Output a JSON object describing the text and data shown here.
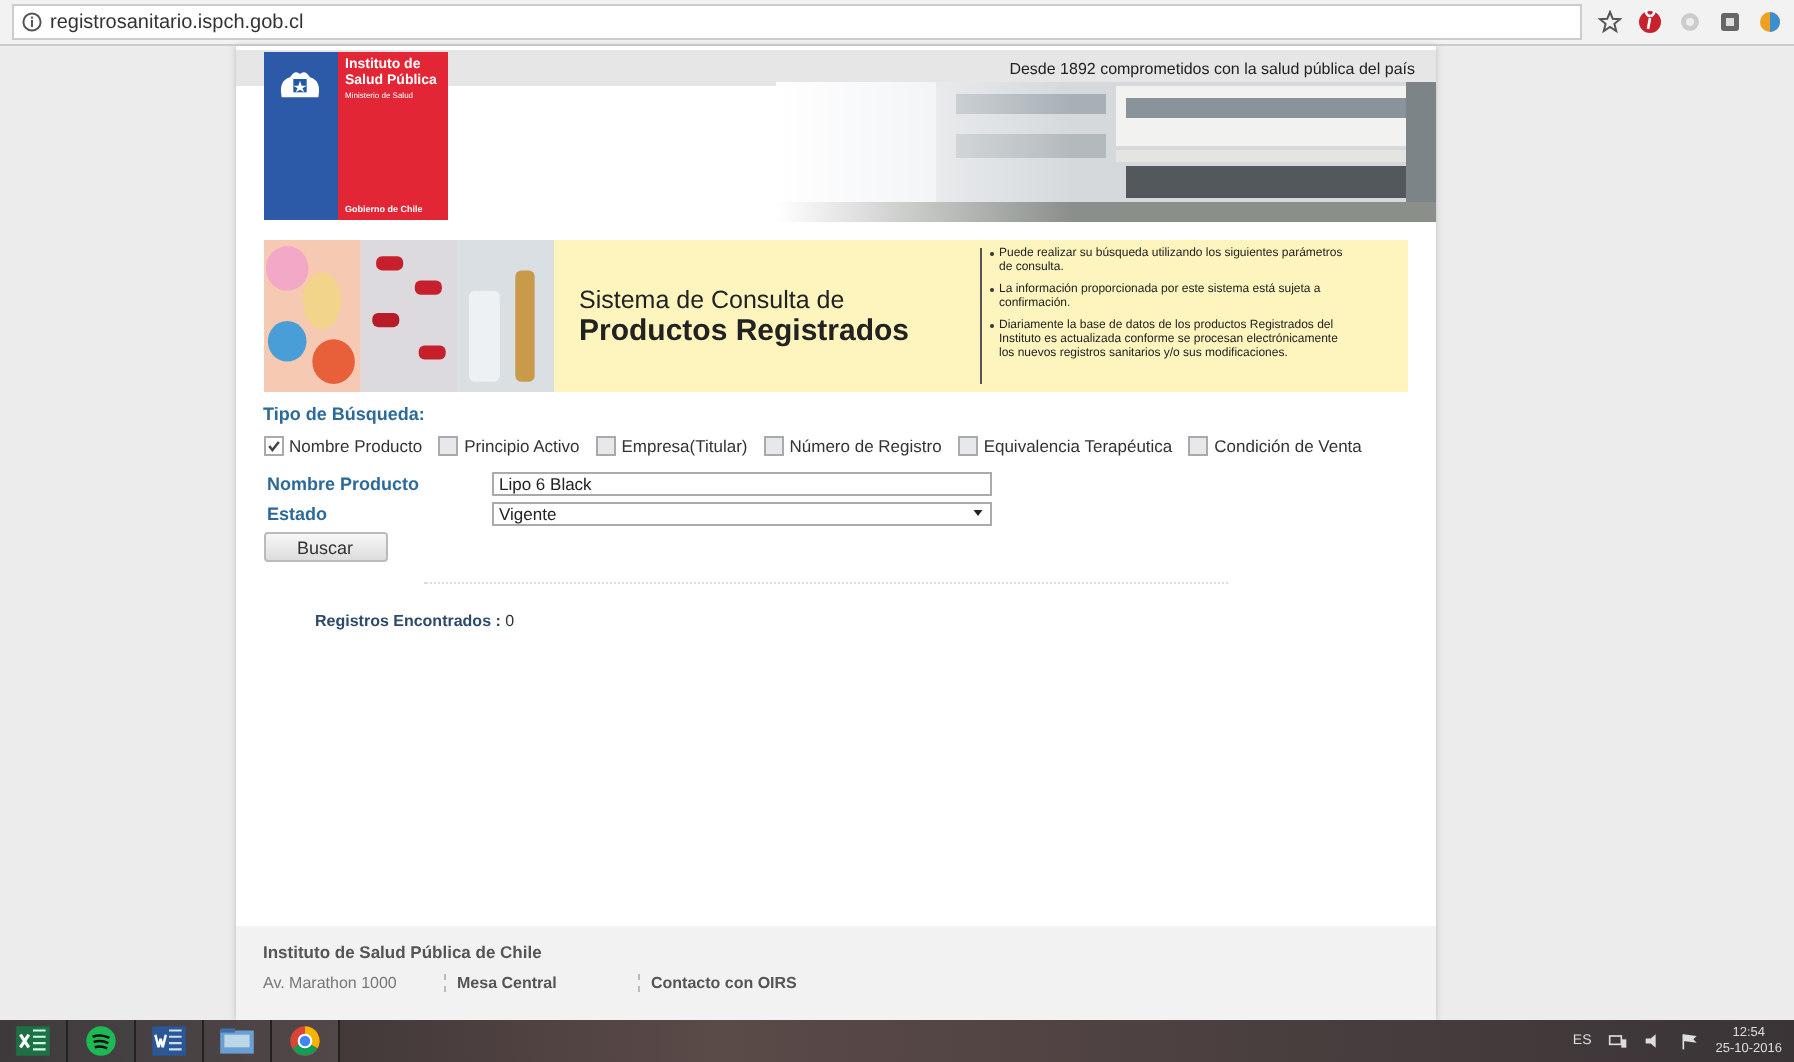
{
  "browser": {
    "url": "registrosanitario.ispch.gob.cl"
  },
  "header": {
    "logo_lines": [
      "Instituto de",
      "Salud Pública"
    ],
    "logo_sub": "Ministerio de Salud",
    "logo_footer": "Gobierno de Chile",
    "tagline": "Desde 1892 comprometidos con la salud pública del país"
  },
  "banner": {
    "title_line_1": "Sistema de Consulta de",
    "title_line_2": "Productos Registrados",
    "notes": [
      "Puede realizar su búsqueda utilizando los siguientes parámetros de consulta.",
      "La información proporcionada por este sistema está sujeta a confirmación.",
      "Diariamente la base de datos de los productos Registrados del Instituto es actualizada conforme se procesan electrónicamente los nuevos registros sanitarios y/o sus modificaciones."
    ]
  },
  "search": {
    "heading": "Tipo de Búsqueda:",
    "types": [
      {
        "label": "Nombre Producto",
        "checked": true
      },
      {
        "label": "Principio Activo",
        "checked": false
      },
      {
        "label": "Empresa(Titular)",
        "checked": false
      },
      {
        "label": "Número de Registro",
        "checked": false
      },
      {
        "label": "Equivalencia Terapéutica",
        "checked": false
      },
      {
        "label": "Condición de Venta",
        "checked": false
      }
    ],
    "fields": [
      {
        "kind": "text",
        "label": "Nombre Producto",
        "value": "Lipo 6 Black"
      },
      {
        "kind": "select",
        "label": "Estado",
        "value": "Vigente"
      }
    ],
    "button": "Buscar"
  },
  "results": {
    "label": "Registros Encontrados :",
    "count": "0"
  },
  "footer": {
    "title": "Instituto de Salud Pública de Chile",
    "columns": [
      {
        "kind": "plain",
        "text": "Av. Marathon 1000"
      },
      {
        "kind": "heading",
        "text": "Mesa Central"
      },
      {
        "kind": "heading",
        "text": "Contacto con OIRS"
      }
    ]
  },
  "taskbar": {
    "language": "ES",
    "time": "12:54",
    "date": "25-10-2016"
  }
}
